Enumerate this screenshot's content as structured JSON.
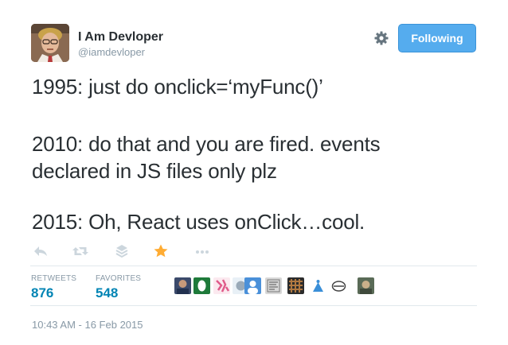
{
  "author": {
    "display_name": "I Am Devloper",
    "handle": "@iamdevloper"
  },
  "follow_button": {
    "label": "Following",
    "color": "#55acee"
  },
  "tweet": {
    "lines": [
      "1995: just do onclick=‘myFunc()’",
      "2010: do that and you are fired. events",
      "declared in JS files only plz",
      "2015: Oh, React uses onClick…cool."
    ]
  },
  "actions": {
    "icons": [
      "reply-icon",
      "retweet-icon",
      "stack-icon",
      "favorite-star-icon",
      "more-icon"
    ],
    "favorited": true,
    "favorite_color": "#ffac33"
  },
  "stats": {
    "retweets_label": "RETWEETS",
    "retweets_count": "876",
    "favorites_label": "FAVORITES",
    "favorites_count": "548"
  },
  "favoriters": {
    "count_shown": 10
  },
  "timestamp": "10:43 AM - 16 Feb 2015"
}
